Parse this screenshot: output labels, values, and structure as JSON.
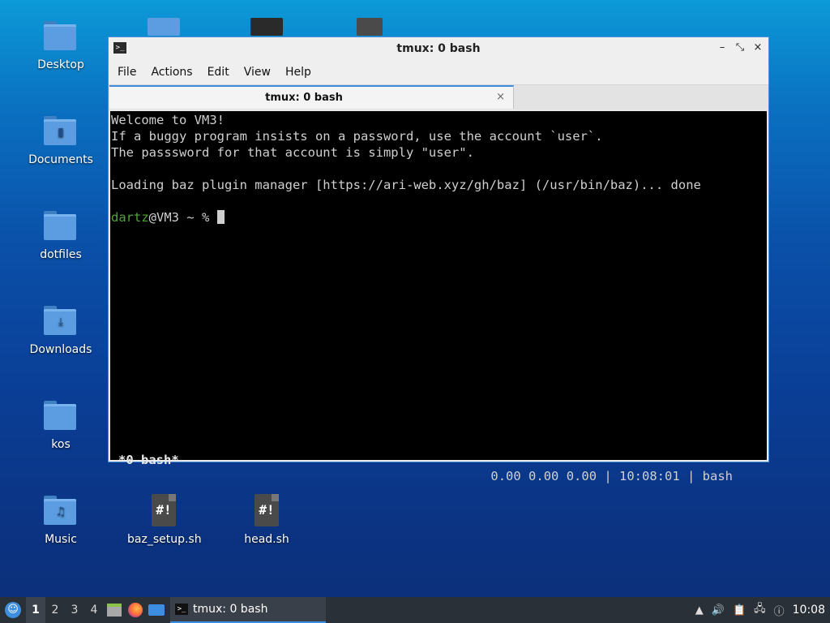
{
  "desktop": {
    "icons": [
      {
        "label": "Desktop"
      },
      {
        "label": "Documents"
      },
      {
        "label": "dotfiles"
      },
      {
        "label": "Downloads"
      },
      {
        "label": "kos"
      },
      {
        "label": "Music"
      },
      {
        "label": "baz_setup.sh"
      },
      {
        "label": "head.sh"
      }
    ]
  },
  "window": {
    "title": "tmux: 0 bash",
    "menu": [
      "File",
      "Actions",
      "Edit",
      "View",
      "Help"
    ],
    "tab_label": "tmux: 0 bash",
    "close_symbol": "×",
    "minimize_symbol": "–"
  },
  "terminal": {
    "lines": [
      "Welcome to VM3!",
      "If a buggy program insists on a password, use the account `user`.",
      "The passsword for that account is simply \"user\".",
      "",
      "Loading baz plugin manager [https://ari-web.xyz/gh/baz] (/usr/bin/baz)... done",
      ""
    ],
    "prompt_user": "dartz",
    "prompt_rest": "@VM3 ~ % ",
    "status_left": "*0 bash*",
    "status_right": "0.00 0.00 0.00 | 10:08:01 | bash"
  },
  "panel": {
    "workspaces": [
      "1",
      "2",
      "3",
      "4"
    ],
    "active_workspace": "1",
    "task_label": "tmux: 0 bash",
    "clock": "10:08"
  },
  "colors": {
    "accent": "#3a8de0",
    "prompt_user": "#52a23a",
    "terminal_bg": "#000000"
  }
}
